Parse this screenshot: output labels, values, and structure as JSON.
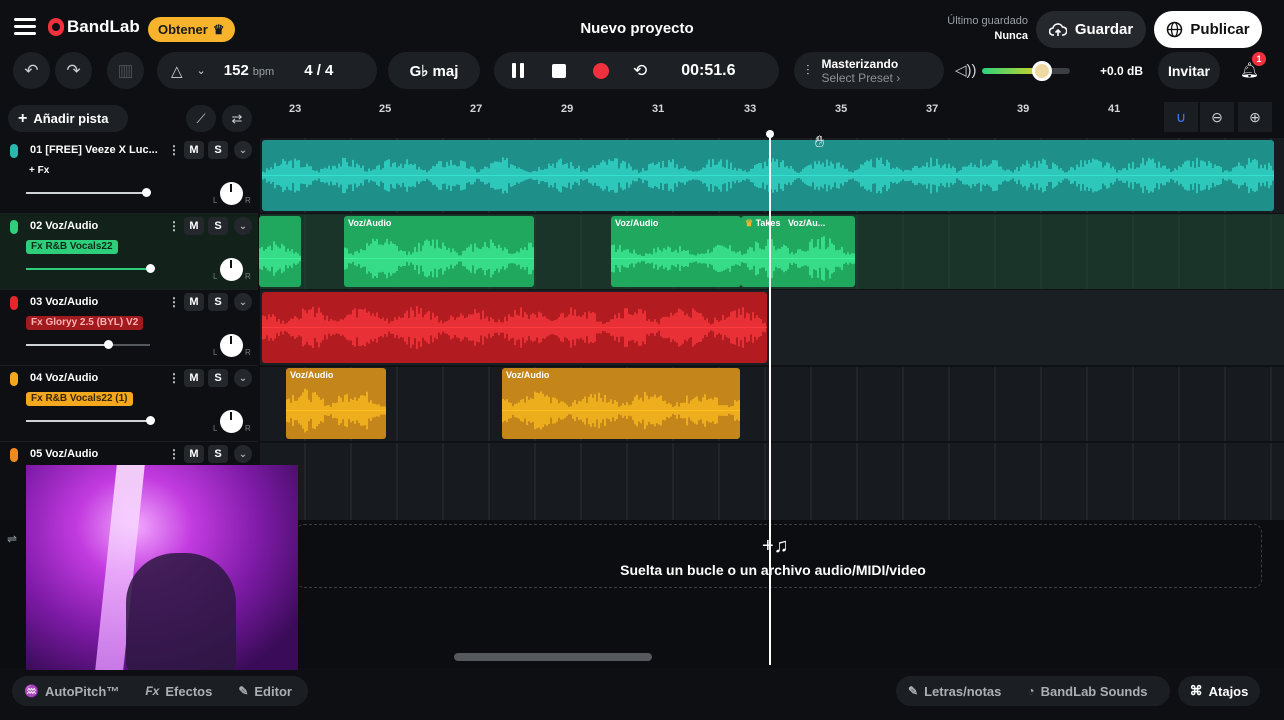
{
  "header": {
    "brand": "BandLab",
    "upgrade_label": "Obtener",
    "project_title": "Nuevo proyecto",
    "last_saved_label": "Último guardado",
    "last_saved_value": "Nunca",
    "save_label": "Guardar",
    "publish_label": "Publicar"
  },
  "transport": {
    "tempo_value": "152",
    "tempo_unit": "bpm",
    "time_signature": "4 / 4",
    "key": "G♭ maj",
    "time": "00:51.6",
    "mastering_title": "Masterizando",
    "mastering_preset": "Select Preset ›",
    "master_volume": "+0.0 dB",
    "master_volume_level": 0.68,
    "invite_label": "Invitar",
    "notification_count": "1"
  },
  "add_track_label": "Añadir pista",
  "ruler": [
    "23",
    "25",
    "27",
    "29",
    "31",
    "33",
    "35",
    "37",
    "39",
    "41"
  ],
  "tracks": [
    {
      "name": "01  [FREE] Veeze X Luc...",
      "fx": "+ Fx",
      "color": "#2ab7b0",
      "volume": 0.97
    },
    {
      "name": "02  Voz/Audio",
      "fx": "Fx R&B Vocals22",
      "color": "#2ecf7a",
      "volume": 1.0
    },
    {
      "name": "03  Voz/Audio",
      "fx": "Fx Gloryy 2.5 (BYL) V2",
      "color": "#e2282d",
      "volume": 0.66
    },
    {
      "name": "04  Voz/Audio",
      "fx": "Fx R&B Vocals22 (1)",
      "color": "#f3a81d",
      "volume": 1.0
    },
    {
      "name": "05  Voz/Audio",
      "fx": "",
      "color": "#f08a1d",
      "volume": 0.0
    }
  ],
  "track_buttons": {
    "mute": "M",
    "solo": "S",
    "pan_left": "L",
    "pan_right": "R"
  },
  "regions": {
    "voz_audio": "Voz/Audio",
    "takes": "Takes",
    "voz_au_short": "Voz/Au..."
  },
  "dropzone_text": "Suelta un bucle o un archivo audio/MIDI/video",
  "footer": {
    "autopitch": "AutoPitch™",
    "effects": "Efectos",
    "editor": "Editor",
    "lyrics": "Letras/notas",
    "sounds": "BandLab Sounds",
    "shortcuts": "Atajos"
  },
  "colors": {
    "brand_red": "#f0303c",
    "accent_gold": "#f7b32b"
  }
}
